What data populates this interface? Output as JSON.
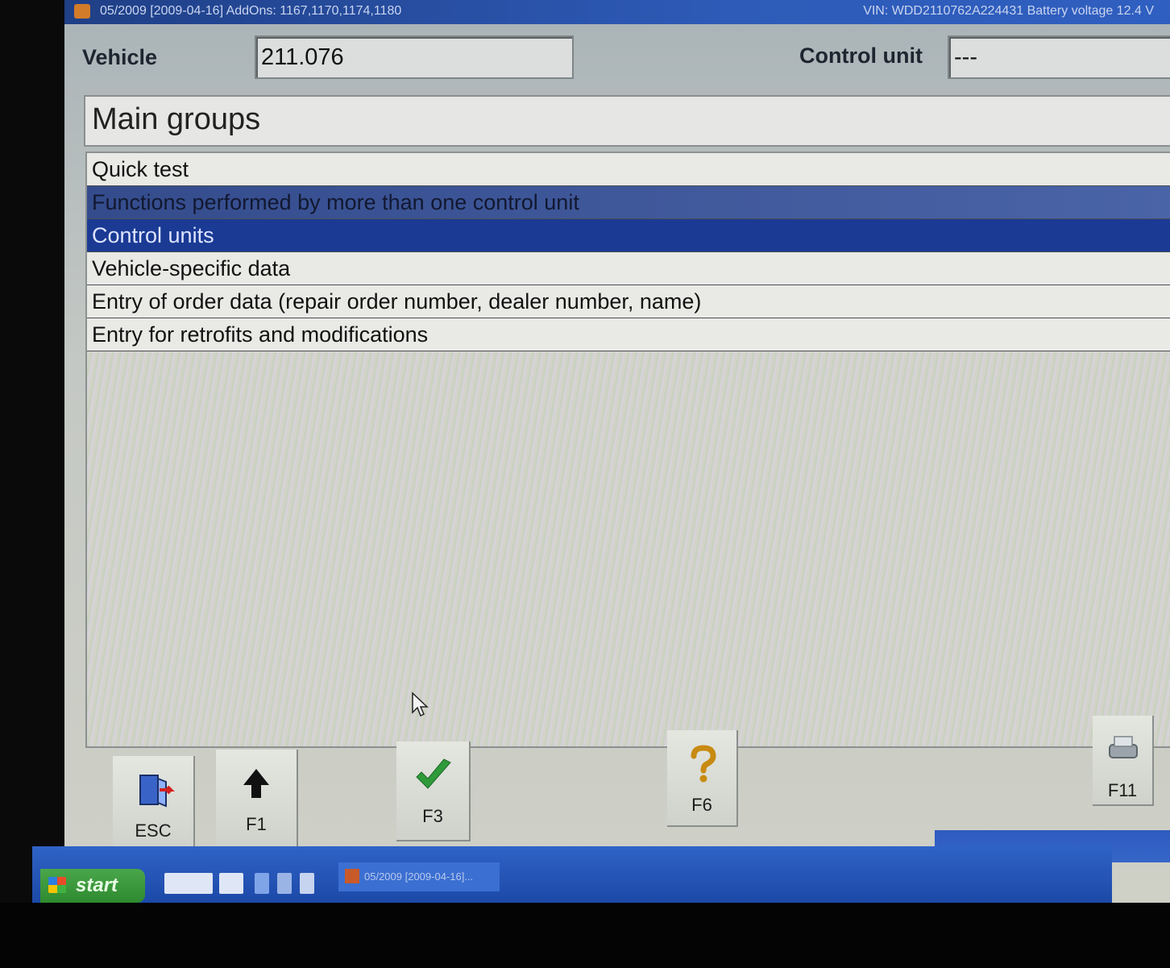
{
  "titlebar": {
    "left_text": "05/2009 [2009-04-16]    AddOns: 1167,1170,1174,1180",
    "right_text": "VIN: WDD2110762A224431     Battery voltage 12.4 V"
  },
  "header": {
    "vehicle_label": "Vehicle",
    "vehicle_value": "211.076",
    "control_unit_label": "Control unit",
    "control_unit_value": "---"
  },
  "group_title": "Main groups",
  "menu": {
    "items": [
      {
        "label": "Quick test"
      },
      {
        "label": "Functions performed by more than one control unit"
      },
      {
        "label": "Control units"
      },
      {
        "label": "Vehicle-specific data"
      },
      {
        "label": "Entry of order data (repair order number, dealer number, name)"
      },
      {
        "label": "Entry for retrofits and modifications"
      }
    ]
  },
  "fkeys": [
    {
      "label": "ESC",
      "icon": "exit-door-icon"
    },
    {
      "label": "F1",
      "icon": "arrow-up-icon"
    },
    {
      "label": "F3",
      "icon": "checkmark-icon"
    },
    {
      "label": "F6",
      "icon": "help-question-icon"
    },
    {
      "label": "F11",
      "icon": "printer-icon"
    }
  ],
  "taskbar": {
    "start_label": "start",
    "task_label": "05/2009 [2009-04-16]..."
  },
  "colors": {
    "selection_primary": "#1a3a94",
    "selection_secondary": "#3e5aa0",
    "taskbar": "#2557c0"
  }
}
